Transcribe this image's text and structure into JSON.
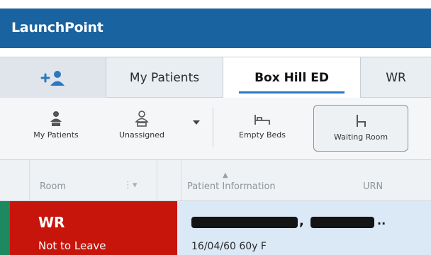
{
  "app": {
    "title": "LaunchPoint"
  },
  "tabs": {
    "add_icon": "add-user-icon",
    "my_patients": "My Patients",
    "box_hill": "Box Hill ED",
    "wr": "WR"
  },
  "toolbar": {
    "my_patients": "My Patients",
    "unassigned": "Unassigned",
    "dropdown_icon": "chevron-down-icon",
    "empty_beds": "Empty Beds",
    "waiting_room": "Waiting Room"
  },
  "columns": {
    "room": "Room",
    "patient_information": "Patient Information",
    "urn": "URN"
  },
  "rows": [
    {
      "room_code": "WR",
      "room_note": "Not to Leave",
      "patient_name": "[redacted]",
      "dob_age_sex": "16/04/60 60y F"
    }
  ],
  "colors": {
    "titlebar": "#1a63a1",
    "room_alert": "#c8150c",
    "status_strip": "#1c8a5e",
    "row_bg": "#dbe8f5",
    "active_tab_underline": "#2b78c2"
  }
}
